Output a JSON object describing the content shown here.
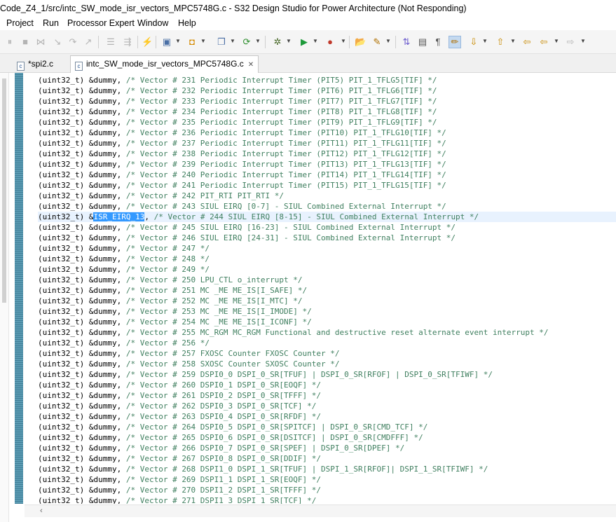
{
  "window": {
    "title": "Code_Z4_1/src/intc_SW_mode_isr_vectors_MPC5748G.c - S32 Design Studio for Power Architecture (Not Responding)"
  },
  "menu": [
    "Project",
    "Run",
    "Processor Expert",
    "Window",
    "Help"
  ],
  "toolbar": {
    "icons": [
      "skip-breakpoints-icon",
      "suspend-icon",
      "disconnect-icon",
      "step-into-icon",
      "step-over-icon",
      "step-return-icon",
      "terminal-icon",
      "drop-to-frame-icon",
      "build-icon",
      "new-wizard-icon",
      "open-type-icon",
      "new-class-icon",
      "debug-icon",
      "settings-icon",
      "run-icon",
      "external-tools-icon",
      "open-folder-icon",
      "launch-icon",
      "toggle-mark-icon",
      "word-wrap-icon",
      "show-whitespace-icon",
      "highlight-icon",
      "next-annotation-icon",
      "prev-annotation-icon",
      "last-edit-icon",
      "back-icon",
      "forward-icon"
    ]
  },
  "tabs": [
    {
      "label": "*spi2.c",
      "active": false
    },
    {
      "label": "intc_SW_mode_isr_vectors_MPC5748G.c",
      "active": true
    }
  ],
  "editor": {
    "lines": [
      {
        "pre": "(uint32_t) &dummy, ",
        "comment": "/* Vector # 231 Periodic Interrupt Timer (PIT5) PIT_1_TFLG5[TIF] */"
      },
      {
        "pre": "(uint32_t) &dummy, ",
        "comment": "/* Vector # 232 Periodic Interrupt Timer (PIT6) PIT_1_TFLG6[TIF] */"
      },
      {
        "pre": "(uint32_t) &dummy, ",
        "comment": "/* Vector # 233 Periodic Interrupt Timer (PIT7) PIT_1_TFLG7[TIF] */"
      },
      {
        "pre": "(uint32_t) &dummy, ",
        "comment": "/* Vector # 234 Periodic Interrupt Timer (PIT8) PIT_1_TFLG8[TIF] */"
      },
      {
        "pre": "(uint32_t) &dummy, ",
        "comment": "/* Vector # 235 Periodic Interrupt Timer (PIT9) PIT_1_TFLG9[TIF] */"
      },
      {
        "pre": "(uint32_t) &dummy, ",
        "comment": "/* Vector # 236 Periodic Interrupt Timer (PIT10) PIT_1_TFLG10[TIF] */"
      },
      {
        "pre": "(uint32_t) &dummy, ",
        "comment": "/* Vector # 237 Periodic Interrupt Timer (PIT11) PIT_1_TFLG11[TIF] */"
      },
      {
        "pre": "(uint32_t) &dummy, ",
        "comment": "/* Vector # 238 Periodic Interrupt Timer (PIT12) PIT_1_TFLG12[TIF] */"
      },
      {
        "pre": "(uint32_t) &dummy, ",
        "comment": "/* Vector # 239 Periodic Interrupt Timer (PIT13) PIT_1_TFLG13[TIF] */"
      },
      {
        "pre": "(uint32_t) &dummy, ",
        "comment": "/* Vector # 240 Periodic Interrupt Timer (PIT14) PIT_1_TFLG14[TIF] */"
      },
      {
        "pre": "(uint32_t) &dummy, ",
        "comment": "/* Vector # 241 Periodic Interrupt Timer (PIT15) PIT_1_TFLG15[TIF] */"
      },
      {
        "pre": "(uint32_t) &dummy, ",
        "comment": "/* Vector # 242 PIT_RTI PIT_RTI */"
      },
      {
        "pre": "(uint32_t) &dummy, ",
        "comment": "/* Vector # 243 SIUL EIRQ [0-7] - SIUL Combined External Interrupt */"
      },
      {
        "pre": "(uint32_t) &",
        "sel": "ISR_EIRQ_13",
        "post": ", ",
        "comment": "/* Vector # 244 SIUL EIRQ [8-15] - SIUL Combined External Interrupt */",
        "current": true
      },
      {
        "pre": "(uint32_t) &dummy, ",
        "comment": "/* Vector # 245 SIUL EIRQ [16-23] - SIUL Combined External Interrupt */"
      },
      {
        "pre": "(uint32_t) &dummy, ",
        "comment": "/* Vector # 246 SIUL EIRQ [24-31] - SIUL Combined External Interrupt */"
      },
      {
        "pre": "(uint32_t) &dummy, ",
        "comment": "/* Vector # 247 */"
      },
      {
        "pre": "(uint32_t) &dummy, ",
        "comment": "/* Vector # 248 */"
      },
      {
        "pre": "(uint32_t) &dummy, ",
        "comment": "/* Vector # 249 */"
      },
      {
        "pre": "(uint32_t) &dummy, ",
        "comment": "/* Vector # 250 LPU_CTL o_interrupt */"
      },
      {
        "pre": "(uint32_t) &dummy, ",
        "comment": "/* Vector # 251 MC _ME ME_IS[I_SAFE] */"
      },
      {
        "pre": "(uint32_t) &dummy, ",
        "comment": "/* Vector # 252 MC _ME ME_IS[I_MTC] */"
      },
      {
        "pre": "(uint32_t) &dummy, ",
        "comment": "/* Vector # 253 MC _ME ME_IS[I_IMODE] */"
      },
      {
        "pre": "(uint32_t) &dummy, ",
        "comment": "/* Vector # 254 MC _ME ME_IS[I_ICONF] */"
      },
      {
        "pre": "(uint32_t) &dummy, ",
        "comment": "/* Vector # 255 MC_RGM MC_RGM Functional and destructive reset alternate event interrupt */"
      },
      {
        "pre": "(uint32_t) &dummy, ",
        "comment": "/* Vector # 256 */"
      },
      {
        "pre": "(uint32_t) &dummy, ",
        "comment": "/* Vector # 257 FXOSC Counter FXOSC Counter */"
      },
      {
        "pre": "(uint32_t) &dummy, ",
        "comment": "/* Vector # 258 SXOSC Counter SXOSC Counter */"
      },
      {
        "pre": "(uint32_t) &dummy, ",
        "comment": "/* Vector # 259 DSPI0_0 DSPI_0_SR[TFUF] | DSPI_0_SR[RFOF] | DSPI_0_SR[TFIWF] */"
      },
      {
        "pre": "(uint32_t) &dummy, ",
        "comment": "/* Vector # 260 DSPI0_1 DSPI_0_SR[EOQF] */"
      },
      {
        "pre": "(uint32_t) &dummy, ",
        "comment": "/* Vector # 261 DSPI0_2 DSPI_0_SR[TFFF] */"
      },
      {
        "pre": "(uint32_t) &dummy, ",
        "comment": "/* Vector # 262 DSPI0_3 DSPI_0_SR[TCF] */"
      },
      {
        "pre": "(uint32_t) &dummy, ",
        "comment": "/* Vector # 263 DSPI0_4 DSPI_0_SR[RFDF] */"
      },
      {
        "pre": "(uint32_t) &dummy, ",
        "comment": "/* Vector # 264 DSPI0_5 DSPI_0_SR[SPITCF] | DSPI_0_SR[CMD_TCF] */"
      },
      {
        "pre": "(uint32_t) &dummy, ",
        "comment": "/* Vector # 265 DSPI0_6 DSPI_0_SR[DSITCF] | DSPI_0_SR[CMDFFF] */"
      },
      {
        "pre": "(uint32_t) &dummy, ",
        "comment": "/* Vector # 266 DSPI0_7 DSPI_0_SR[SPEF] | DSPI_0_SR[DPEF] */"
      },
      {
        "pre": "(uint32_t) &dummy, ",
        "comment": "/* Vector # 267 DSPI0_8 DSPI_0_SR[DDIF] */"
      },
      {
        "pre": "(uint32_t) &dummy, ",
        "comment": "/* Vector # 268 DSPI1_0 DSPI_1_SR[TFUF] | DSPI_1_SR[RFOF]| DSPI_1_SR[TFIWF] */"
      },
      {
        "pre": "(uint32_t) &dummy, ",
        "comment": "/* Vector # 269 DSPI1_1 DSPI_1_SR[EOQF] */"
      },
      {
        "pre": "(uint32_t) &dummy, ",
        "comment": "/* Vector # 270 DSPI1_2 DSPI_1_SR[TFFF] */"
      },
      {
        "pre": "(uint32_t) &dummy, ",
        "comment": "/* Vector # 271 DSPI1_3 DSPI_1_SR[TCF] */"
      }
    ]
  },
  "colors": {
    "comment": "#3f7f5f",
    "selection": "#3399ff",
    "current_line": "#e8f2fe",
    "ruler": "#5b9bb3"
  }
}
